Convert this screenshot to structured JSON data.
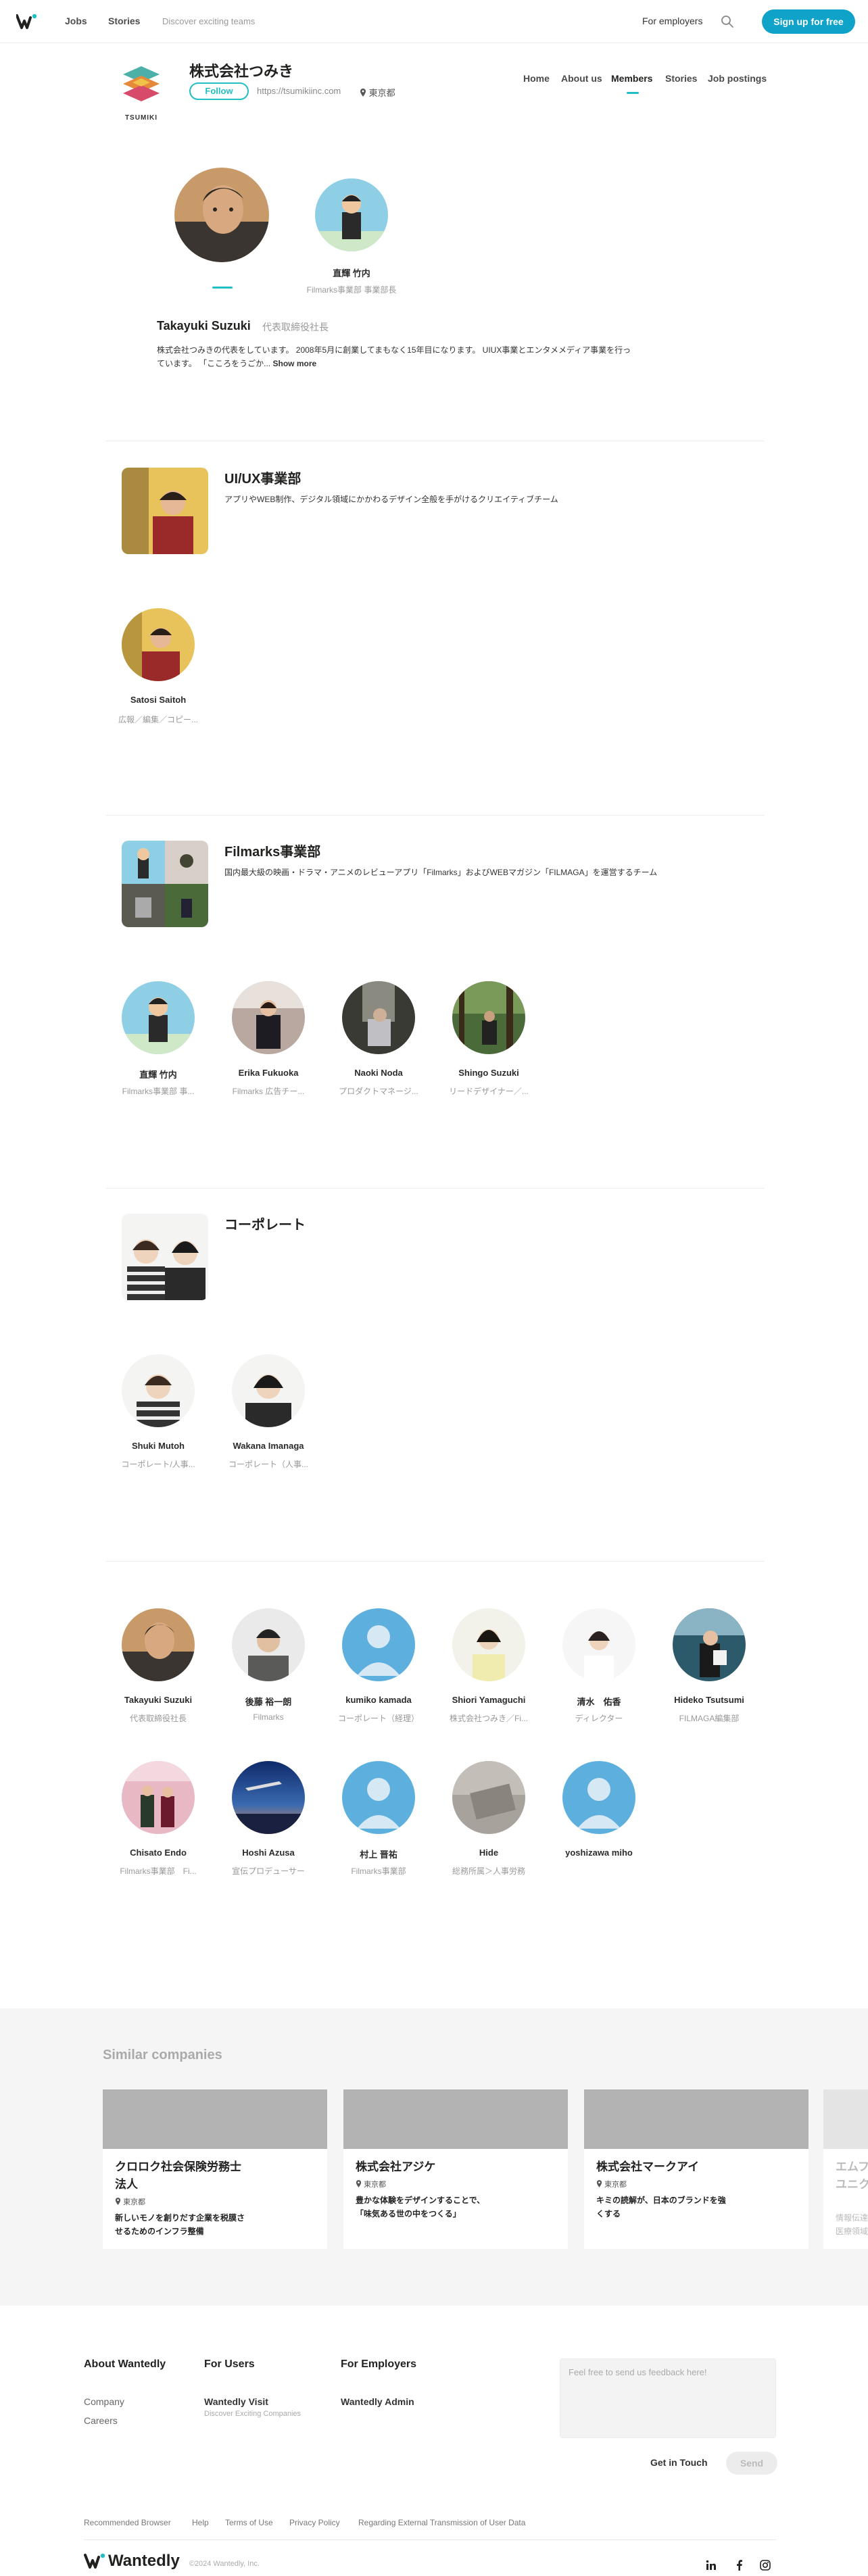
{
  "nav": {
    "jobs": "Jobs",
    "stories": "Stories",
    "discover": "Discover exciting teams",
    "for_employers": "For employers",
    "signup": "Sign up for free"
  },
  "company": {
    "logo_text": "TSUMIKI",
    "name": "株式会社つみき",
    "follow": "Follow",
    "url": "https://tsumikiinc.com",
    "location": "東京都",
    "tabs": [
      "Home",
      "About us",
      "Members",
      "Stories",
      "Job postings"
    ],
    "active_tab": "Members"
  },
  "featured": {
    "members": [
      {
        "name": "",
        "role": ""
      },
      {
        "name": "直輝 竹内",
        "role": "Filmarks事業部 事業部長"
      }
    ],
    "selected_name": "Takayuki Suzuki",
    "selected_role": "代表取締役社長",
    "bio_line1": "株式会社つみきの代表をしています。 2008年5月に創業してまもなく15年目になります。 UIUX事業とエンタメメディア事業を行っ",
    "bio_line2": "ています。 「こころをうごか...",
    "show_more": "Show more"
  },
  "teams": [
    {
      "title": "UI/UX事業部",
      "desc": "アプリやWEB制作、デジタル領域にかかわるデザイン全般を手がけるクリエイティブチーム",
      "members": [
        {
          "name": "Satosi Saitoh",
          "role": "広報／編集／コピー..."
        }
      ]
    },
    {
      "title": "Filmarks事業部",
      "desc": "国内最大級の映画・ドラマ・アニメのレビューアプリ「Filmarks」およびWEBマガジン「FILMAGA」を運営するチーム",
      "members": [
        {
          "name": "直輝 竹内",
          "role": "Filmarks事業部 事..."
        },
        {
          "name": "Erika Fukuoka",
          "role": "Filmarks 広告チー..."
        },
        {
          "name": "Naoki Noda",
          "role": "プロダクトマネージ..."
        },
        {
          "name": "Shingo Suzuki",
          "role": "リードデザイナー／..."
        }
      ]
    },
    {
      "title": "コーポレート",
      "desc": "",
      "members": [
        {
          "name": "Shuki Mutoh",
          "role": "コーポレート/人事..."
        },
        {
          "name": "Wakana Imanaga",
          "role": "コーポレート（人事..."
        }
      ]
    }
  ],
  "all_members": [
    {
      "name": "Takayuki Suzuki",
      "role": "代表取締役社長"
    },
    {
      "name": "後藤 裕一朗",
      "role": "Filmarks"
    },
    {
      "name": "kumiko kamada",
      "role": "コーポレート（経理）"
    },
    {
      "name": "Shiori Yamaguchi",
      "role": "株式会社つみき／Fi..."
    },
    {
      "name": "清水　佑香",
      "role": "ディレクター"
    },
    {
      "name": "Hideko Tsutsumi",
      "role": "FILMAGA編集部"
    },
    {
      "name": "Chisato Endo",
      "role": "Filmarks事業部　Fi..."
    },
    {
      "name": "Hoshi Azusa",
      "role": "宣伝プロデューサー"
    },
    {
      "name": "村上 晋祐",
      "role": "Filmarks事業部"
    },
    {
      "name": "Hide",
      "role": "総務所属＞人事労務"
    },
    {
      "name": "yoshizawa miho",
      "role": ""
    }
  ],
  "similar": {
    "title": "Similar companies",
    "cards": [
      {
        "name_line1": "クロロク社会保険労務士",
        "name_line2": "法人",
        "location": "東京都",
        "desc_line1": "新しいモノを創りだす企業を税膜さ",
        "desc_line2": "せるためのインフラ整備"
      },
      {
        "name_line1": "株式会社アジケ",
        "name_line2": "",
        "location": "東京都",
        "desc_line1": "豊かな体験をデザインすることで、",
        "desc_line2": "「味気ある世の中をつくる」"
      },
      {
        "name_line1": "株式会社マークアイ",
        "name_line2": "",
        "location": "東京都",
        "desc_line1": "キミの読解が、日本のブランドを強",
        "desc_line2": "くする"
      },
      {
        "name_line1": "エムフ",
        "name_line2": "ユニク",
        "location": "",
        "desc_line1": "情報伝達",
        "desc_line2": "医療領域"
      }
    ]
  },
  "footer": {
    "about": "About Wantedly",
    "company": "Company",
    "careers": "Careers",
    "for_users": "For Users",
    "wantedly_visit": "Wantedly Visit",
    "visit_sub": "Discover Exciting Companies",
    "for_employers": "For Employers",
    "wantedly_admin": "Wantedly Admin",
    "feedback_placeholder": "Feel free to send us feedback here!",
    "get_in_touch": "Get in Touch",
    "send": "Send",
    "legal": [
      "Recommended Browser",
      "Help",
      "Terms of Use",
      "Privacy Policy",
      "Regarding External Transmission of User Data"
    ],
    "brand": "Wantedly",
    "copyright": "©2024 Wantedly, Inc."
  },
  "colors": {
    "accent": "#21bfc4",
    "signup": "#0fa3c9"
  }
}
